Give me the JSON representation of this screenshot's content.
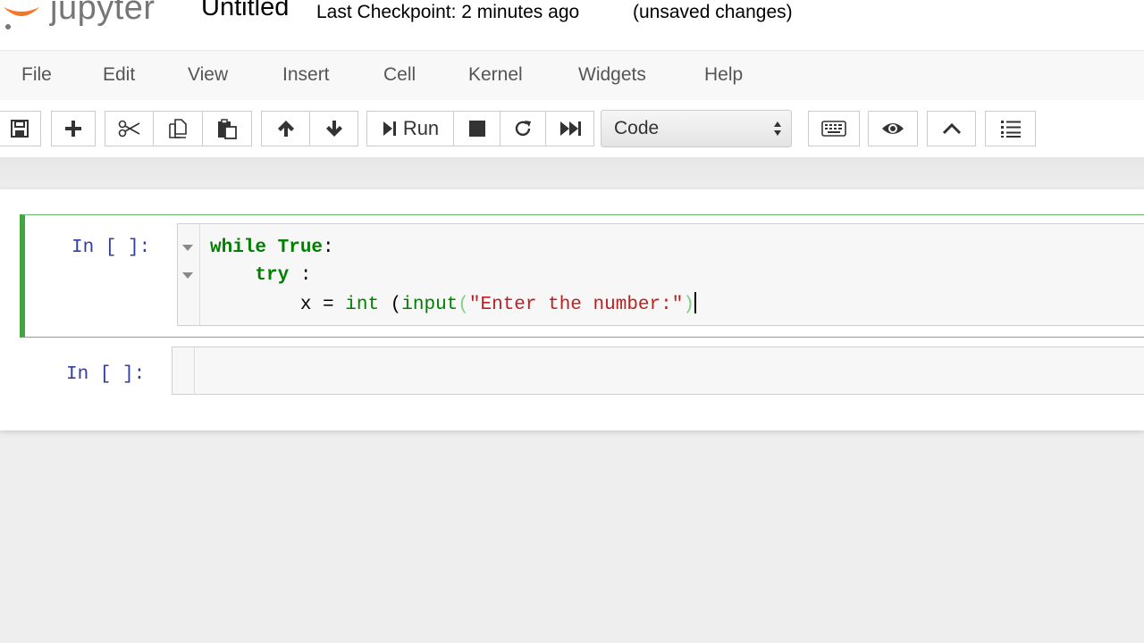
{
  "header": {
    "logo_text": "jupyter",
    "notebook_name": "Untitled",
    "checkpoint": "Last Checkpoint: 2 minutes ago",
    "autosave_status": "(unsaved changes)"
  },
  "menubar": {
    "items": [
      "File",
      "Edit",
      "View",
      "Insert",
      "Cell",
      "Kernel",
      "Widgets",
      "Help"
    ]
  },
  "toolbar": {
    "buttons": [
      {
        "icon": "save-icon"
      },
      {
        "icon": "plus-icon"
      },
      {
        "icon": "scissors-icon"
      },
      {
        "icon": "copy-icon"
      },
      {
        "icon": "paste-icon"
      },
      {
        "icon": "arrow-up-icon"
      },
      {
        "icon": "arrow-down-icon"
      },
      {
        "icon": "step-forward-icon",
        "label": "Run"
      },
      {
        "icon": "stop-icon"
      },
      {
        "icon": "restart-icon"
      },
      {
        "icon": "fast-forward-icon"
      },
      {
        "icon": "keyboard-icon"
      },
      {
        "icon": "eye-icon"
      },
      {
        "icon": "chevron-up-icon"
      },
      {
        "icon": "list-icon"
      }
    ],
    "cell_type": "Code"
  },
  "cells": [
    {
      "prompt": "In [ ]:",
      "selected": true,
      "lines": [
        [
          {
            "t": "while",
            "c": "kw"
          },
          {
            "t": " "
          },
          {
            "t": "True",
            "c": "kw"
          },
          {
            "t": ":"
          }
        ],
        [
          {
            "t": "    "
          },
          {
            "t": "try",
            "c": "kw"
          },
          {
            "t": " :"
          }
        ],
        [
          {
            "t": "        x = "
          },
          {
            "t": "int",
            "c": "bi"
          },
          {
            "t": " ("
          },
          {
            "t": "input",
            "c": "bi"
          },
          {
            "t": "(",
            "c": "pm"
          },
          {
            "t": "\"Enter the number:\"",
            "c": "st"
          },
          {
            "t": ")",
            "c": "pm"
          }
        ]
      ]
    },
    {
      "prompt": "In [ ]:",
      "selected": false,
      "lines": []
    }
  ],
  "colors": {
    "selected_cell_border": "#42a542",
    "prompt": "#303f9f",
    "keyword": "#008000",
    "string": "#ba2121"
  }
}
